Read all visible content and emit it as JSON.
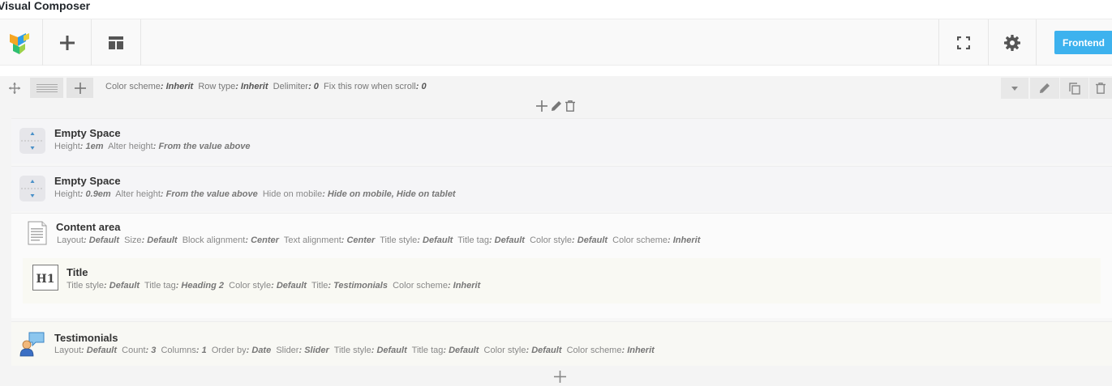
{
  "page": {
    "title": "Visual Composer"
  },
  "toolbar": {
    "logo_icon": "vc-logo-icon",
    "add_icon": "plus-icon",
    "templates_icon": "layout-icon",
    "fullscreen_icon": "fullscreen-icon",
    "settings_icon": "gear-icon",
    "frontend_label": "Frontend",
    "accent": "#3db2ee"
  },
  "row": {
    "params": [
      {
        "label": "Color scheme",
        "value": ": Inherit"
      },
      {
        "label": "Row type",
        "value": ": Inherit"
      },
      {
        "label": "Delimiter",
        "value": ": 0"
      },
      {
        "label": "Fix this row when scroll",
        "value": ": 0"
      }
    ]
  },
  "elements": {
    "space1": {
      "name": "Empty Space",
      "params": [
        {
          "label": "Height",
          "value": ": 1em"
        },
        {
          "label": "Alter height",
          "value": ": From the value above"
        }
      ]
    },
    "space2": {
      "name": "Empty Space",
      "params": [
        {
          "label": "Height",
          "value": ": 0.9em"
        },
        {
          "label": "Alter height",
          "value": ": From the value above"
        },
        {
          "label": "Hide on mobile",
          "value": ": Hide on mobile, Hide on tablet"
        }
      ]
    },
    "content": {
      "name": "Content area",
      "params": [
        {
          "label": "Layout",
          "value": ": Default"
        },
        {
          "label": "Size",
          "value": ": Default"
        },
        {
          "label": "Block alignment",
          "value": ": Center"
        },
        {
          "label": "Text alignment",
          "value": ": Center"
        },
        {
          "label": "Title style",
          "value": ": Default"
        },
        {
          "label": "Title tag",
          "value": ": Default"
        },
        {
          "label": "Color style",
          "value": ": Default"
        },
        {
          "label": "Color scheme",
          "value": ": Inherit"
        }
      ]
    },
    "title": {
      "name": "Title",
      "icon_text": "H1",
      "params": [
        {
          "label": "Title style",
          "value": ": Default"
        },
        {
          "label": "Title tag",
          "value": ": Heading 2"
        },
        {
          "label": "Color style",
          "value": ": Default"
        },
        {
          "label": "Title",
          "value": ": Testimonials"
        },
        {
          "label": "Color scheme",
          "value": ": Inherit"
        }
      ]
    },
    "testimonials": {
      "name": "Testimonials",
      "params": [
        {
          "label": "Layout",
          "value": ": Default"
        },
        {
          "label": "Count",
          "value": ": 3"
        },
        {
          "label": "Columns",
          "value": ": 1"
        },
        {
          "label": "Order by",
          "value": ": Date"
        },
        {
          "label": "Slider",
          "value": ": Slider"
        },
        {
          "label": "Title style",
          "value": ": Default"
        },
        {
          "label": "Title tag",
          "value": ": Default"
        },
        {
          "label": "Color style",
          "value": ": Default"
        },
        {
          "label": "Color scheme",
          "value": ": Inherit"
        }
      ]
    }
  }
}
